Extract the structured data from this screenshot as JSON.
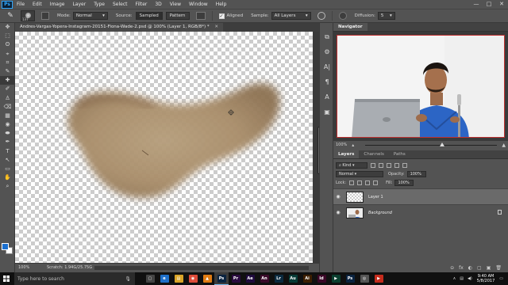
{
  "app": {
    "logo": "Ps",
    "menus": [
      "File",
      "Edit",
      "Image",
      "Layer",
      "Type",
      "Select",
      "Filter",
      "3D",
      "View",
      "Window",
      "Help"
    ],
    "window_controls": [
      "—",
      "□",
      "✕"
    ]
  },
  "options": {
    "brush_size": "137",
    "mode_label": "Mode:",
    "mode_value": "Normal",
    "source_label": "Source:",
    "sampled_label": "Sampled",
    "pattern_label": "Pattern",
    "aligned_label": "Aligned",
    "sample_label": "Sample:",
    "sample_value": "All Layers",
    "diffusion_label": "Diffusion:",
    "diffusion_value": "5"
  },
  "tools": [
    "✥",
    "⬚",
    "ʘ",
    "⌖",
    "⌗",
    "✎",
    "✚",
    "✐",
    "♙",
    "⌫",
    "▦",
    "◉",
    "⬬",
    "✒",
    "T",
    "↖",
    "▭",
    "✋",
    "⌕"
  ],
  "document": {
    "tab_title": "Andres-Vargas-Yopera-Instagram-20151-Fiona-Wade-2.psd @ 100% (Layer 1, RGB/8*) *",
    "zoom": "100%",
    "status": "Scratch: 1.94G/25.75G"
  },
  "side_icons": [
    "⧉",
    "⚙",
    "A|",
    "¶",
    "A",
    "▣"
  ],
  "navigator": {
    "tab": "Navigator",
    "zoom": "100%"
  },
  "layers_panel": {
    "tabs": [
      "Layers",
      "Channels",
      "Paths"
    ],
    "kind_label": "Kind",
    "blend_mode": "Normal",
    "opacity_label": "Opacity:",
    "opacity_value": "100%",
    "lock_label": "Lock:",
    "fill_label": "Fill:",
    "fill_value": "100%",
    "layers": [
      {
        "name": "Layer 1",
        "selected": true
      },
      {
        "name": "Background",
        "selected": false
      }
    ],
    "footer_icons": [
      "⊝",
      "fx",
      "◐",
      "▢",
      "▣",
      "🗑"
    ]
  },
  "taskbar": {
    "search_placeholder": "Type here to search",
    "apps": [
      {
        "label": "▢",
        "color": "#444444"
      },
      {
        "label": "e",
        "color": "#1e6fc8"
      },
      {
        "label": "▤",
        "color": "#d9a428"
      },
      {
        "label": "◉",
        "color": "#dd4b39"
      },
      {
        "label": "▲",
        "color": "#e07b12"
      },
      {
        "label": "Ps",
        "color": "#0a2340"
      },
      {
        "label": "Pr",
        "color": "#2a0b3f"
      },
      {
        "label": "Ae",
        "color": "#1f0a3d"
      },
      {
        "label": "An",
        "color": "#3a0a2a"
      },
      {
        "label": "Lr",
        "color": "#0b2a3f"
      },
      {
        "label": "Au",
        "color": "#063a36"
      },
      {
        "label": "Ai",
        "color": "#3d1f00"
      },
      {
        "label": "Id",
        "color": "#3a0626"
      },
      {
        "label": "▶",
        "color": "#0b3f2f"
      },
      {
        "label": "Ps",
        "color": "#0a2340"
      },
      {
        "label": "◎",
        "color": "#555555"
      },
      {
        "label": "▶",
        "color": "#c42b1c"
      }
    ],
    "time": "9:40 AM",
    "date": "5/8/2017"
  }
}
